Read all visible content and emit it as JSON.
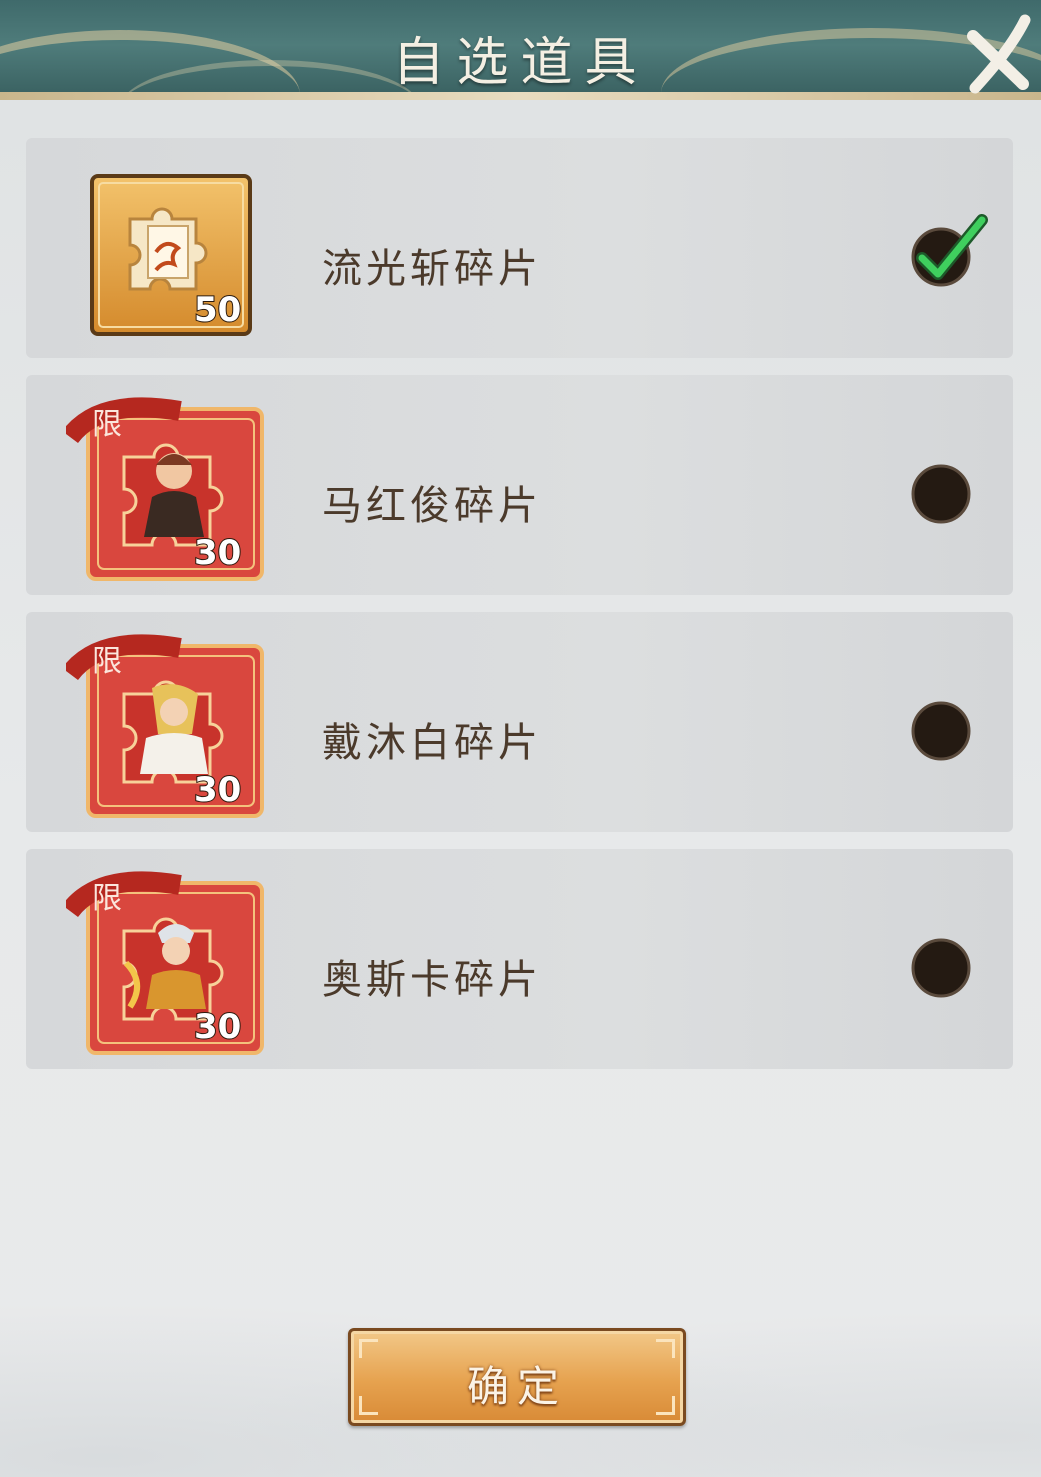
{
  "header": {
    "title": "自选道具",
    "close_icon": "close-x-icon"
  },
  "items": [
    {
      "name": "流光斩碎片",
      "count": "50",
      "limited": false,
      "selected": true,
      "icon": "skill-scroll-fragment-icon"
    },
    {
      "name": "马红俊碎片",
      "count": "30",
      "limited": true,
      "selected": false,
      "limited_label": "限",
      "icon": "character-fragment-icon"
    },
    {
      "name": "戴沐白碎片",
      "count": "30",
      "limited": true,
      "selected": false,
      "limited_label": "限",
      "icon": "character-fragment-icon"
    },
    {
      "name": "奥斯卡碎片",
      "count": "30",
      "limited": true,
      "selected": false,
      "limited_label": "限",
      "icon": "character-fragment-icon"
    }
  ],
  "confirm": {
    "label": "确定"
  },
  "colors": {
    "accent": "#e6a24f",
    "header": "#4f7c7b",
    "check": "#39c05a"
  }
}
